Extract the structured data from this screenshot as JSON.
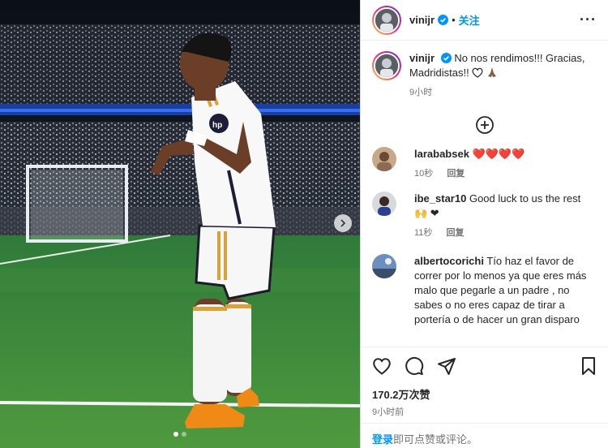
{
  "post": {
    "username": "vinijr",
    "follow_label": "关注",
    "more_label": "···",
    "caption_text": "No nos rendimos!!! Gracias, Madridistas!! ",
    "caption_time": "9小时",
    "views": "170.2万次赞",
    "posted_time": "9小时前",
    "login_link": "登录",
    "login_suffix": "即可点赞或评论。"
  },
  "comments": [
    {
      "username": "larababsek",
      "text": "❤️❤️❤️❤️",
      "time": "10秒",
      "reply_label": "回复"
    },
    {
      "username": "ibe_star10",
      "text": "Good luck to us the rest 🙌 ❤",
      "time": "11秒",
      "reply_label": "回复"
    },
    {
      "username": "albertocorichi",
      "text": "Tío haz el favor de correr por lo menos ya que eres más malo que pegarle a un padre , no sabes o no eres capaz de tirar a portería o de hacer un gran disparo",
      "time": "",
      "reply_label": ""
    }
  ],
  "colors": {
    "follow_blue": "#0095f6",
    "verified_blue": "#0095f6",
    "heart_red": "#e0241b",
    "meta_gray": "#737373"
  },
  "icons": {
    "verified": "verified-badge-icon",
    "add_comment": "plus-circle-icon",
    "like": "heart-outline-icon",
    "comment": "speech-bubble-icon",
    "share": "paper-plane-icon",
    "save": "bookmark-icon",
    "carousel_next": "chevron-right-icon"
  },
  "carousel": {
    "slide_count": 2,
    "active_index": 0
  }
}
